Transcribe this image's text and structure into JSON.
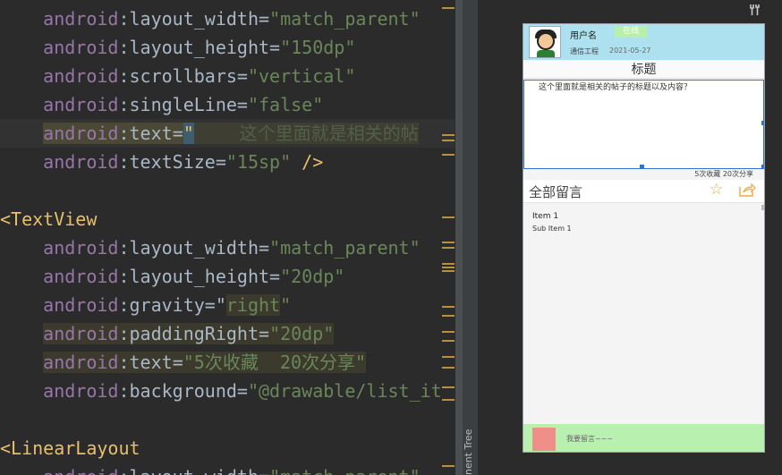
{
  "editor": {
    "lines": [
      {
        "indent": "    ",
        "parts": [
          {
            "t": "android",
            "c": "attr"
          },
          {
            "t": ":layout_width",
            "c": "attr2"
          },
          {
            "t": "=",
            "c": "eq"
          },
          {
            "t": "\"match_parent\"",
            "c": "val"
          }
        ]
      }
    ],
    "l1_ns": "android",
    "l1_attr": ":layout_width",
    "l1_eq": "=",
    "l1_val": "\"match_parent\"",
    "l2_ns": "android",
    "l2_attr": ":layout_height",
    "l2_eq": "=",
    "l2_val": "\"150dp\"",
    "l3_ns": "android",
    "l3_attr": ":scrollbars",
    "l3_eq": "=",
    "l3_val": "\"vertical\"",
    "l4_ns": "android",
    "l4_attr": ":singleLine",
    "l4_eq": "=",
    "l4_val": "\"false\"",
    "l5_ns": "android",
    "l5_attr": ":text",
    "l5_eq": "=",
    "l5_quote": "\"",
    "l5_val": "        这个里面就是相关的帖",
    "l6_ns": "android",
    "l6_attr": ":textSize",
    "l6_eq": "=",
    "l6_val": "\"15sp\"",
    "l6_close": " />",
    "l8_tag": "<TextView",
    "l9_ns": "android",
    "l9_attr": ":layout_width",
    "l9_eq": "=",
    "l9_val": "\"match_parent\"",
    "l10_ns": "android",
    "l10_attr": ":layout_height",
    "l10_eq": "=",
    "l10_val": "\"20dp\"",
    "l11_ns": "android",
    "l11_attr": ":gravity",
    "l11_eq": "=\"",
    "l11_val": "right",
    "l11_end": "\"",
    "l12_ns": "android",
    "l12_attr": ":paddingRight",
    "l12_eq": "=",
    "l12_val": "\"20dp\"",
    "l13_ns": "android",
    "l13_attr": ":text",
    "l13_eq": "=",
    "l13_val": "\"5次收藏  20次分享\"",
    "l14_ns": "android",
    "l14_attr": ":background",
    "l14_eq": "=",
    "l14_val": "\"@drawable/list_it",
    "l16_tag": "<LinearLayout",
    "l17_ns": "android",
    "l17_attr": ":layout_width",
    "l17_eq": "=",
    "l17_val": "\"match_parent\""
  },
  "sidebar": {
    "component_tree_label": "nent Tree"
  },
  "toolbar": {
    "wrench_icon": "wrench-icon"
  },
  "phone": {
    "header": {
      "username": "用户名",
      "badge": "在线",
      "department": "通信工程",
      "date": "2021-05-27"
    },
    "post": {
      "title": "标题",
      "body": "这个里面就是相关的帖子的标题以及内容？",
      "stats": "5次收藏  20次分享"
    },
    "comments": {
      "title": "全部留言",
      "star_icon": "star-icon",
      "share_icon": "share-icon"
    },
    "list": {
      "item_title": "Item 1",
      "item_sub": "Sub Item 1"
    },
    "footer": {
      "input_placeholder": "我要留言~~~"
    }
  },
  "colors": {
    "editor_bg": "#2b2b2b",
    "attr": "#9876aa",
    "value": "#6a8759",
    "tag": "#e8bf6a",
    "header_bg": "#aee1f0",
    "footer_bg": "#b8f0b0",
    "selection": "#2d74d6"
  }
}
